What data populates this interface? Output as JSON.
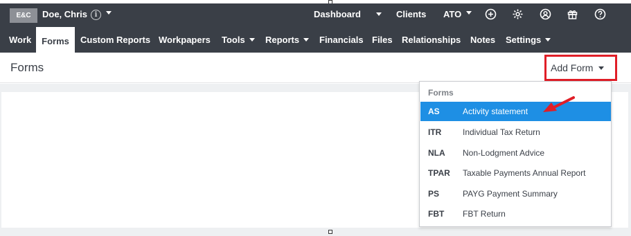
{
  "client": {
    "badge": "E&C",
    "name": "Doe, Chris",
    "info_glyph": "i"
  },
  "topbar": {
    "links": {
      "dashboard": "Dashboard",
      "clients": "Clients",
      "ato": "ATO"
    },
    "icons": [
      "add-icon",
      "gear-icon",
      "user-icon",
      "gift-icon",
      "help-icon"
    ]
  },
  "nav": {
    "work": "Work",
    "forms": "Forms",
    "custom_reports": "Custom Reports",
    "workpapers": "Workpapers",
    "tools": "Tools",
    "reports": "Reports",
    "financials": "Financials",
    "files": "Files",
    "relationships": "Relationships",
    "notes": "Notes",
    "settings": "Settings",
    "active": "Forms"
  },
  "page": {
    "title": "Forms",
    "add_form_label": "Add Form"
  },
  "dropdown": {
    "header": "Forms",
    "items": [
      {
        "code": "AS",
        "label": "Activity statement",
        "selected": true
      },
      {
        "code": "ITR",
        "label": "Individual Tax Return",
        "selected": false
      },
      {
        "code": "NLA",
        "label": "Non-Lodgment Advice",
        "selected": false
      },
      {
        "code": "TPAR",
        "label": "Taxable Payments Annual Report",
        "selected": false
      },
      {
        "code": "PS",
        "label": "PAYG Payment Summary",
        "selected": false
      },
      {
        "code": "FBT",
        "label": "FBT Return",
        "selected": false
      }
    ]
  },
  "colors": {
    "bar": "#3a3f47",
    "highlight": "#1e8fe4",
    "annotation": "#e01e27"
  }
}
